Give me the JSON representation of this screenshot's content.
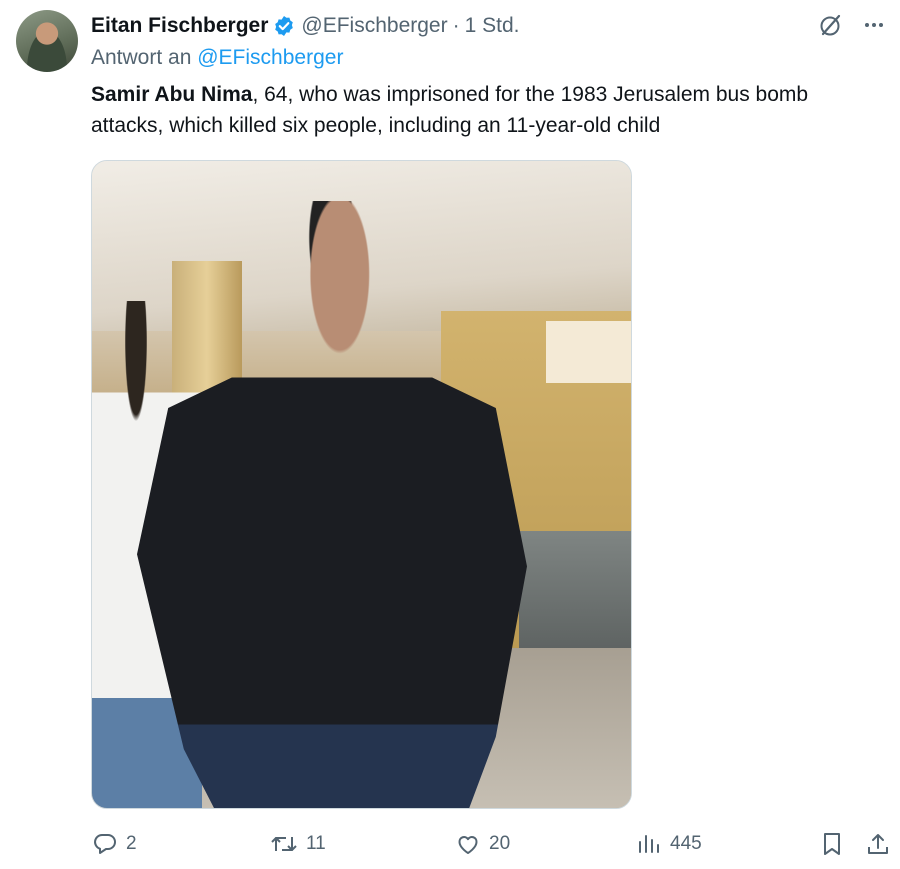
{
  "author": {
    "display_name": "Eitan Fischberger",
    "handle": "@EFischberger",
    "separator": "·",
    "time": "1 Std.",
    "verified_color": "#1d9bf0"
  },
  "reply": {
    "prefix": "Antwort an",
    "mention": "@EFischberger"
  },
  "tweet": {
    "bold_name": "Samir Abu Nima",
    "text": ", 64, who was imprisoned for the 1983 Jerusalem bus bomb attacks, which killed six people, including an 11-year-old child"
  },
  "actions": {
    "replies": "2",
    "retweets": "11",
    "likes": "20",
    "views": "445"
  },
  "icons": {
    "top": [
      "grok-icon",
      "more-icon"
    ],
    "bottom": [
      "reply-icon",
      "retweet-icon",
      "like-icon",
      "views-icon",
      "bookmark-icon",
      "share-icon"
    ]
  },
  "colors": {
    "text": "#0f1419",
    "secondary": "#536471",
    "link": "#1d9bf0"
  }
}
